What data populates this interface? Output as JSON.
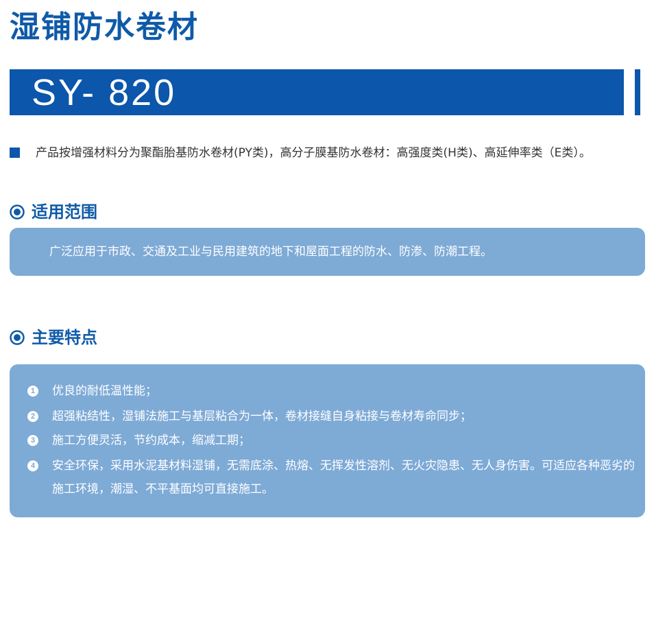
{
  "header": {
    "title": "湿铺防水卷材",
    "model": "SY- 820"
  },
  "intro": {
    "text": "产品按增强材料分为聚酯胎基防水卷材(PY类)，高分子膜基防水卷材：高强度类(H类)、高延伸率类（E类）。"
  },
  "scope": {
    "heading": "适用范围",
    "text": "广泛应用于市政、交通及工业与民用建筑的地下和屋面工程的防水、防渗、防潮工程。"
  },
  "features": {
    "heading": "主要特点",
    "items": [
      {
        "num": "1",
        "text": "优良的耐低温性能；"
      },
      {
        "num": "2",
        "text": "超强粘结性，湿铺法施工与基层粘合为一体，卷材接缝自身粘接与卷材寿命同步；"
      },
      {
        "num": "3",
        "text": "施工方便灵活，节约成本，缩减工期；"
      },
      {
        "num": "4",
        "text": "安全环保，采用水泥基材料湿铺，无需底涂、热熔、无挥发性溶剂、无火灾隐患、无人身伤害。可适应各种恶劣的施工环境，潮湿、不平基面均可直接施工。"
      }
    ]
  },
  "colors": {
    "brand_blue": "#0c56ab",
    "panel_blue": "#7eaad6",
    "text_dark": "#333333"
  },
  "icons": {
    "section_icon": "target-circle-icon",
    "intro_bullet": "square-bullet-icon"
  }
}
